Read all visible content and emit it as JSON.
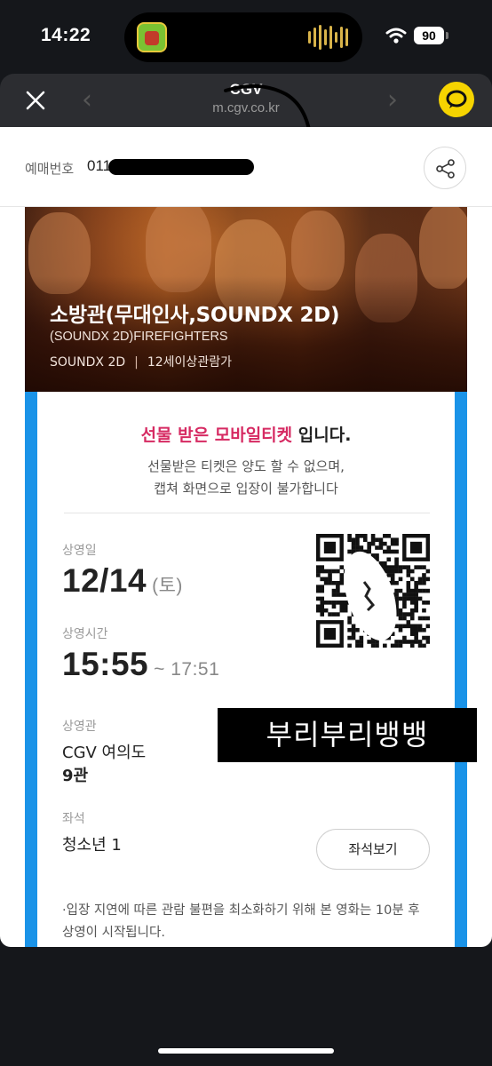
{
  "status": {
    "time": "14:22",
    "battery": "90"
  },
  "browser": {
    "title": "CGV",
    "url": "m.cgv.co.kr"
  },
  "reservation": {
    "label": "예매번호",
    "number": "0112"
  },
  "movie": {
    "title": "소방관(무대인사,SOUNDX 2D)",
    "english_title": "(SOUNDX 2D)FIREFIGHTERS",
    "format": "SOUNDX 2D",
    "separator": "|",
    "rating": "12세이상관람가"
  },
  "ticket": {
    "gift_highlight": "선물 받은 모바일티켓",
    "gift_suffix": " 입니다.",
    "notice_line1": "선물받은 티켓은 양도 할 수 없으며,",
    "notice_line2": "캡쳐 화면으로 입장이 불가합니다",
    "date_label": "상영일",
    "date": "12/14",
    "day": "(토)",
    "time_label": "상영시간",
    "start_time": "15:55",
    "end_time": "~ 17:51",
    "theater_label": "상영관",
    "theater": "CGV 여의도",
    "screen": "9관",
    "seat_label": "좌석",
    "seat": "청소년 1",
    "seat_button": "좌석보기",
    "bottom_note": "·입장 지연에 따른 관람 불편을 최소화하기 위해 본 영화는 10분 후 상영이 시작됩니다."
  },
  "sticker": {
    "text": "부리부리뱅뱅"
  },
  "icons": {
    "close": "close-icon",
    "back": "chevron-left-icon",
    "forward": "chevron-right-icon",
    "talk": "talk-bubble-icon",
    "share": "share-icon",
    "wifi": "wifi-icon",
    "qr": "qr-code-icon"
  },
  "colors": {
    "accent_blue": "#1a93e8",
    "gift_pink": "#d62a62",
    "kakao_yellow": "#f6d400"
  }
}
